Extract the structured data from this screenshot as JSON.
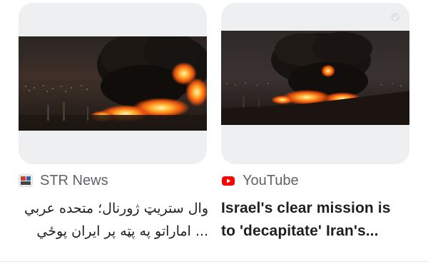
{
  "cards": [
    {
      "source": {
        "name": "STR News",
        "icon": "str-news-logo"
      },
      "headline_lines": [
        "وال ستریټ ژورنال؛ متحده عربي",
        "... اماراتو په پټه پر ایران پوځي"
      ],
      "thumbnail": "night-fire-explosion-image"
    },
    {
      "source": {
        "name": "YouTube",
        "icon": "youtube-play-icon",
        "color": "#ff0000"
      },
      "headline_lines": [
        "Israel's clear mission is",
        "to 'decapitate' Iran's..."
      ],
      "thumbnail": "night-fire-explosion-image"
    }
  ],
  "colors": {
    "card_bg": "#eeeff1",
    "source_text": "#5f6368",
    "headline_text": "#1f1f1f"
  }
}
